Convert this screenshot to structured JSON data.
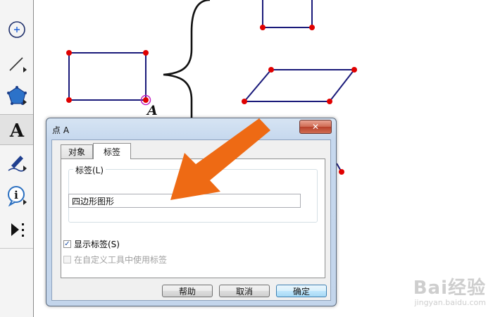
{
  "canvas": {
    "point_label": "A"
  },
  "dialog": {
    "title": "点 A",
    "close_symbol": "✕",
    "tabs": [
      {
        "label": "对象",
        "active": false
      },
      {
        "label": "标签",
        "active": true
      }
    ],
    "label_group": {
      "legend": "标签(L)",
      "input_value": "四边形图形"
    },
    "show_label": {
      "label": "显示标签(S)",
      "checked": true
    },
    "use_in_custom_tools": {
      "label": "在自定义工具中使用标签",
      "checked": false,
      "enabled": false
    },
    "buttons": {
      "help": "帮助",
      "cancel": "取消",
      "ok": "确定"
    }
  },
  "watermark": {
    "brand": "Bai经验",
    "url": "jingyan.baidu.com"
  },
  "colors": {
    "segment": "#1a1a7a",
    "point": "#e00000",
    "arrow": "#ee6a14"
  },
  "icons": [
    "point-tool-icon",
    "segment-tool-icon",
    "polygon-tool-icon",
    "text-tool-icon",
    "marker-tool-icon",
    "info-tool-icon",
    "custom-tools-icon",
    "close-icon",
    "checkbox-icon",
    "arrow-annotation"
  ]
}
